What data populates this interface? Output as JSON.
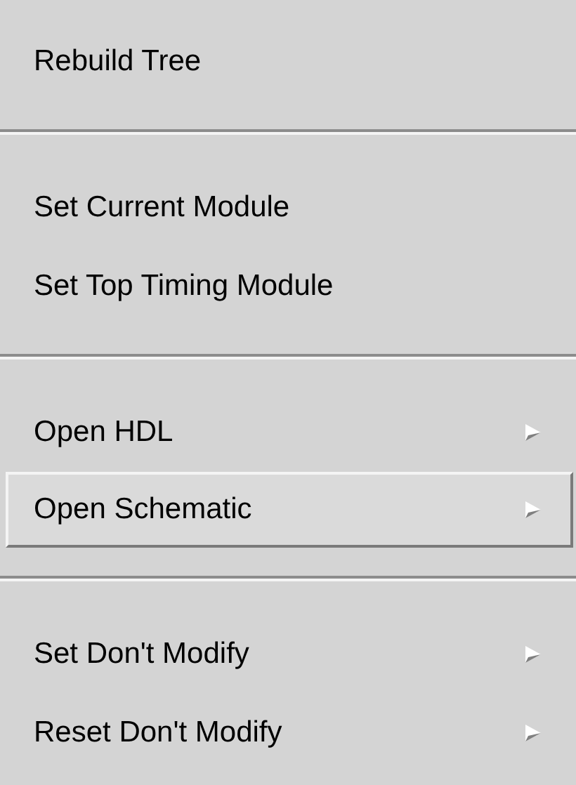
{
  "menu": {
    "groups": [
      {
        "items": [
          {
            "label": "Rebuild Tree",
            "submenu": false,
            "selected": false
          }
        ]
      },
      {
        "items": [
          {
            "label": "Set Current Module",
            "submenu": false,
            "selected": false
          },
          {
            "label": "Set Top Timing Module",
            "submenu": false,
            "selected": false
          }
        ]
      },
      {
        "items": [
          {
            "label": "Open HDL",
            "submenu": true,
            "selected": false
          },
          {
            "label": "Open Schematic",
            "submenu": true,
            "selected": true
          }
        ]
      },
      {
        "items": [
          {
            "label": "Set Don't Modify",
            "submenu": true,
            "selected": false
          },
          {
            "label": "Reset Don't Modify",
            "submenu": true,
            "selected": false
          }
        ]
      }
    ]
  }
}
